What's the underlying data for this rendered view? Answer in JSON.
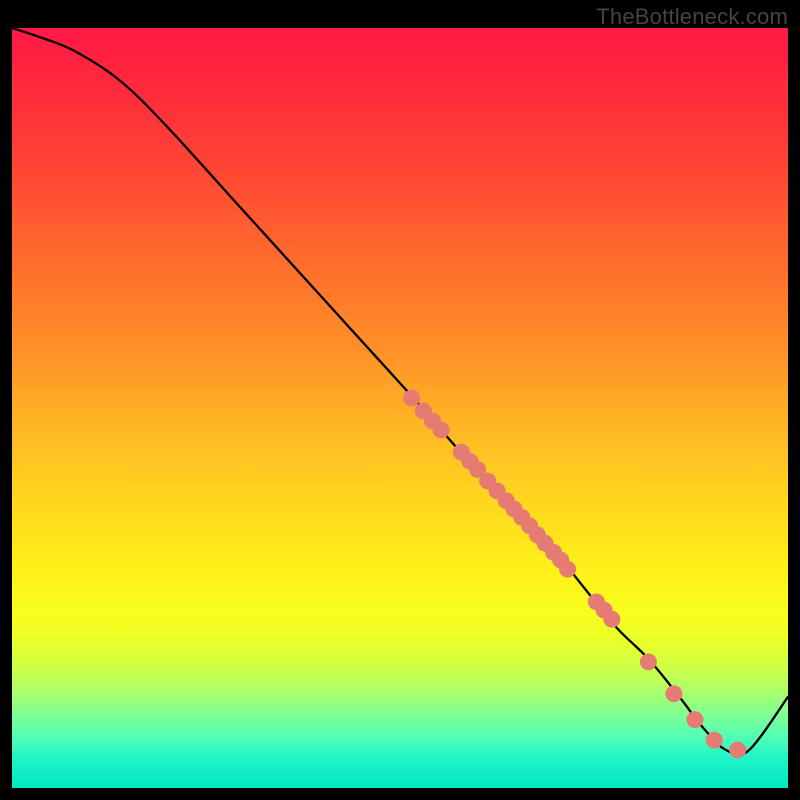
{
  "watermark": "TheBottleneck.com",
  "chart_data": {
    "type": "line",
    "title": "",
    "xlabel": "",
    "ylabel": "",
    "xlim": [
      0,
      100
    ],
    "ylim": [
      0,
      100
    ],
    "curve": {
      "x": [
        0,
        3,
        8,
        14,
        20,
        28,
        36,
        44,
        52,
        58,
        62,
        66,
        70,
        74,
        78,
        82,
        86,
        89,
        92,
        95,
        100
      ],
      "y": [
        100,
        99,
        97,
        93,
        87,
        78,
        69,
        60,
        51,
        44,
        40,
        35,
        31,
        26,
        21,
        17,
        12,
        8,
        5,
        5,
        12
      ]
    },
    "markers": {
      "color": "#e57b72",
      "radius": 1.1,
      "points": [
        {
          "x": 51.5,
          "y": 51.3
        },
        {
          "x": 53.0,
          "y": 49.6
        },
        {
          "x": 54.2,
          "y": 48.3
        },
        {
          "x": 55.3,
          "y": 47.1
        },
        {
          "x": 57.9,
          "y": 44.2
        },
        {
          "x": 59.0,
          "y": 43.0
        },
        {
          "x": 60.0,
          "y": 41.9
        },
        {
          "x": 61.3,
          "y": 40.4
        },
        {
          "x": 62.5,
          "y": 39.1
        },
        {
          "x": 63.7,
          "y": 37.8
        },
        {
          "x": 64.7,
          "y": 36.7
        },
        {
          "x": 65.7,
          "y": 35.6
        },
        {
          "x": 66.7,
          "y": 34.5
        },
        {
          "x": 67.7,
          "y": 33.3
        },
        {
          "x": 68.7,
          "y": 32.2
        },
        {
          "x": 69.8,
          "y": 31.0
        },
        {
          "x": 70.7,
          "y": 30.0
        },
        {
          "x": 71.6,
          "y": 28.8
        },
        {
          "x": 75.3,
          "y": 24.5
        },
        {
          "x": 76.3,
          "y": 23.4
        },
        {
          "x": 77.3,
          "y": 22.2
        },
        {
          "x": 82.0,
          "y": 16.6
        },
        {
          "x": 85.3,
          "y": 12.4
        },
        {
          "x": 88.0,
          "y": 9.0
        },
        {
          "x": 90.5,
          "y": 6.3
        },
        {
          "x": 93.5,
          "y": 5.0
        }
      ]
    }
  }
}
